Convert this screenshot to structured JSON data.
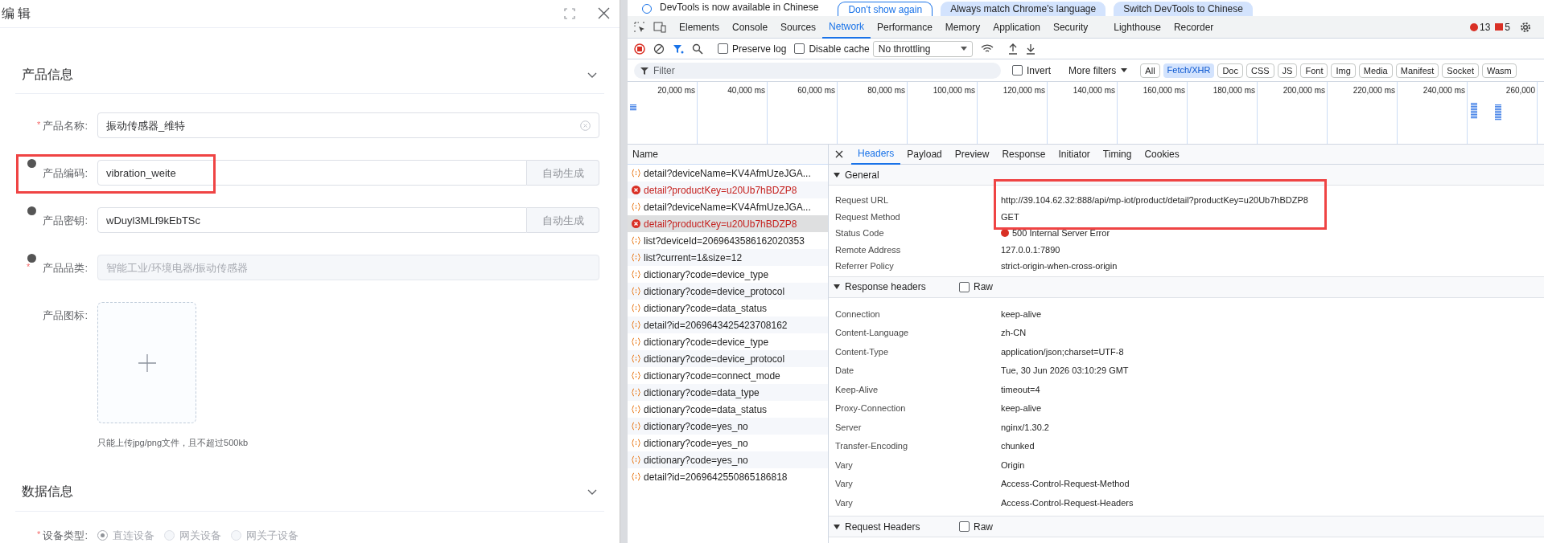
{
  "dialog": {
    "title": "编 辑",
    "sections": [
      {
        "title": "产品信息",
        "expanded": true
      },
      {
        "title": "数据信息",
        "expanded": true
      }
    ],
    "fields": [
      {
        "kind": "text",
        "label": "产品名称:",
        "required_mark": "*",
        "info": false,
        "value": "振动传感器_维特",
        "clearable": true
      },
      {
        "kind": "addon",
        "label": "产品编码:",
        "info": true,
        "value": "vibration_weite",
        "addon": "自动生成",
        "highlighted": true
      },
      {
        "kind": "addon",
        "label": "产品密钥:",
        "info": true,
        "value": "wDuyl3MLf9kEbTSc",
        "addon": "自动生成",
        "highlighted": false
      },
      {
        "kind": "disabled",
        "label": "产品品类:",
        "required_mark": "*",
        "info": true,
        "placeholder": "智能工业/环境电器/振动传感器"
      },
      {
        "kind": "upload",
        "label": "产品图标:",
        "info": false,
        "hint": "只能上传jpg/png文件，且不超过500kb"
      }
    ],
    "radio_field": {
      "label": "设备类型:",
      "required_mark": "*",
      "options": [
        {
          "label": "直连设备",
          "selected": true
        },
        {
          "label": "网关设备",
          "selected": false
        },
        {
          "label": "网关子设备",
          "selected": false
        }
      ]
    }
  },
  "devtools": {
    "banner": {
      "text": "DevTools is now available in Chinese",
      "buttons": [
        "Don't show again",
        "Always match Chrome's language",
        "Switch DevTools to Chinese"
      ]
    },
    "tabs": [
      {
        "label": "Elements",
        "selected": false
      },
      {
        "label": "Console",
        "selected": false
      },
      {
        "label": "Sources",
        "selected": false
      },
      {
        "label": "Network",
        "selected": true
      },
      {
        "label": "Performance",
        "selected": false
      },
      {
        "label": "Memory",
        "selected": false
      },
      {
        "label": "Application",
        "selected": false
      },
      {
        "label": "Security",
        "selected": false
      },
      {
        "label": "Lighthouse",
        "selected": false
      },
      {
        "label": "Recorder",
        "selected": false
      }
    ],
    "error_count": "13",
    "warning_count": "5",
    "toolbar": {
      "preserve_log": {
        "label": "Preserve log",
        "checked": false
      },
      "disable_cache": {
        "label": "Disable cache",
        "checked": false
      },
      "throttling": "No throttling"
    },
    "filter": {
      "placeholder": "Filter",
      "invert": {
        "label": "Invert",
        "checked": false
      },
      "more_filters": "More filters",
      "types": [
        {
          "label": "All",
          "selected": false
        },
        {
          "label": "Fetch/XHR",
          "selected": true
        },
        {
          "label": "Doc",
          "selected": false
        },
        {
          "label": "CSS",
          "selected": false
        },
        {
          "label": "JS",
          "selected": false
        },
        {
          "label": "Font",
          "selected": false
        },
        {
          "label": "Img",
          "selected": false
        },
        {
          "label": "Media",
          "selected": false
        },
        {
          "label": "Manifest",
          "selected": false
        },
        {
          "label": "Socket",
          "selected": false
        },
        {
          "label": "Wasm",
          "selected": false
        }
      ]
    },
    "timeline_ticks": [
      "20,000 ms",
      "40,000 ms",
      "60,000 ms",
      "80,000 ms",
      "100,000 ms",
      "120,000 ms",
      "140,000 ms",
      "160,000 ms",
      "180,000 ms",
      "200,000 ms",
      "220,000 ms",
      "240,000 ms",
      "260,000"
    ],
    "requests_header": "Name",
    "requests": [
      {
        "kind": "xhr",
        "name": "detail?deviceName=KV4AfmUzeJGA...",
        "selected": false
      },
      {
        "kind": "error",
        "name": "detail?productKey=u20Ub7hBDZP8",
        "selected": false
      },
      {
        "kind": "xhr",
        "name": "detail?deviceName=KV4AfmUzeJGA...",
        "selected": false
      },
      {
        "kind": "error",
        "name": "detail?productKey=u20Ub7hBDZP8",
        "selected": true
      },
      {
        "kind": "xhr",
        "name": "list?deviceId=2069643586162020353",
        "selected": false
      },
      {
        "kind": "xhr",
        "name": "list?current=1&size=12",
        "selected": false
      },
      {
        "kind": "xhr",
        "name": "dictionary?code=device_type",
        "selected": false
      },
      {
        "kind": "xhr",
        "name": "dictionary?code=device_protocol",
        "selected": false
      },
      {
        "kind": "xhr",
        "name": "dictionary?code=data_status",
        "selected": false
      },
      {
        "kind": "xhr",
        "name": "detail?id=2069643425423708162",
        "selected": false
      },
      {
        "kind": "xhr",
        "name": "dictionary?code=device_type",
        "selected": false
      },
      {
        "kind": "xhr",
        "name": "dictionary?code=device_protocol",
        "selected": false
      },
      {
        "kind": "xhr",
        "name": "dictionary?code=connect_mode",
        "selected": false
      },
      {
        "kind": "xhr",
        "name": "dictionary?code=data_type",
        "selected": false
      },
      {
        "kind": "xhr",
        "name": "dictionary?code=data_status",
        "selected": false
      },
      {
        "kind": "xhr",
        "name": "dictionary?code=yes_no",
        "selected": false
      },
      {
        "kind": "xhr",
        "name": "dictionary?code=yes_no",
        "selected": false
      },
      {
        "kind": "xhr",
        "name": "dictionary?code=yes_no",
        "selected": false
      },
      {
        "kind": "xhr",
        "name": "detail?id=2069642550865186818",
        "selected": false
      }
    ],
    "detail_tabs": [
      {
        "label": "Headers",
        "selected": true
      },
      {
        "label": "Payload",
        "selected": false
      },
      {
        "label": "Preview",
        "selected": false
      },
      {
        "label": "Response",
        "selected": false
      },
      {
        "label": "Initiator",
        "selected": false
      },
      {
        "label": "Timing",
        "selected": false
      },
      {
        "label": "Cookies",
        "selected": false
      }
    ],
    "general": {
      "title": "General",
      "expanded": true,
      "rows": [
        {
          "name": "Request URL",
          "value": "http://39.104.62.32:888/api/mp-iot/product/detail?productKey=u20Ub7hBDZP8"
        },
        {
          "name": "Request Method",
          "value": "GET"
        },
        {
          "name": "Status Code",
          "value": "500 Internal Server Error",
          "color": "#d93025"
        },
        {
          "name": "Remote Address",
          "value": "127.0.0.1:7890"
        },
        {
          "name": "Referrer Policy",
          "value": "strict-origin-when-cross-origin"
        }
      ]
    },
    "response_headers": {
      "title": "Response headers",
      "expanded": true,
      "raw": {
        "label": "Raw",
        "checked": false
      },
      "rows": [
        {
          "name": "Connection",
          "value": "keep-alive"
        },
        {
          "name": "Content-Language",
          "value": "zh-CN"
        },
        {
          "name": "Content-Type",
          "value": "application/json;charset=UTF-8"
        },
        {
          "name": "Date",
          "value": "Tue, 30 Jun 2026 03:10:29 GMT"
        },
        {
          "name": "Keep-Alive",
          "value": "timeout=4"
        },
        {
          "name": "Proxy-Connection",
          "value": "keep-alive"
        },
        {
          "name": "Server",
          "value": "nginx/1.30.2"
        },
        {
          "name": "Transfer-Encoding",
          "value": "chunked"
        },
        {
          "name": "Vary",
          "value": "Origin"
        },
        {
          "name": "Vary",
          "value": "Access-Control-Request-Method"
        },
        {
          "name": "Vary",
          "value": "Access-Control-Request-Headers"
        }
      ]
    },
    "request_headers": {
      "title": "Request Headers",
      "expanded": true,
      "raw": {
        "label": "Raw",
        "checked": false
      }
    }
  }
}
